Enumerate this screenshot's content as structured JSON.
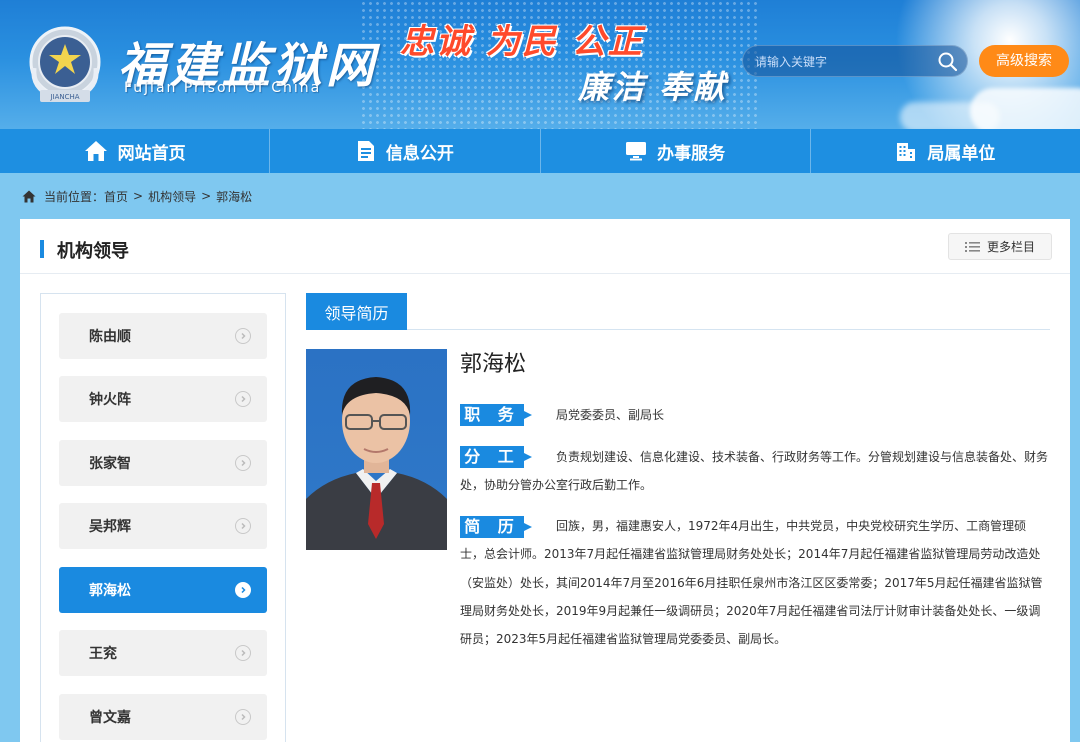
{
  "header": {
    "logo_cn": "福建监狱网",
    "logo_en": "Fujian Prison Of China",
    "emblem_text": "JIANCHA",
    "slogan_line1": "忠诚 为民 公正",
    "slogan_line2": "廉洁 奉献",
    "search_placeholder": "请输入关键字",
    "advanced_search_label": "高级搜索",
    "colors": {
      "primary": "#1a8ae0",
      "nav": "#1e8fe1",
      "accent_orange": "#ff8a17",
      "slogan_red": "#ff4a2b"
    }
  },
  "nav": {
    "items": [
      {
        "label": "网站首页",
        "icon": "home-icon"
      },
      {
        "label": "信息公开",
        "icon": "document-icon"
      },
      {
        "label": "办事服务",
        "icon": "monitor-icon"
      },
      {
        "label": "局属单位",
        "icon": "building-icon"
      }
    ]
  },
  "breadcrumb": {
    "prefix": "当前位置：",
    "items": [
      "首页",
      "机构领导",
      "郭海松"
    ],
    "separator": ">"
  },
  "panel": {
    "title": "机构领导",
    "more_label": "更多栏目"
  },
  "sidebar": {
    "items": [
      {
        "label": "陈由顺",
        "active": false
      },
      {
        "label": "钟火阵",
        "active": false
      },
      {
        "label": "张家智",
        "active": false
      },
      {
        "label": "吴邦辉",
        "active": false
      },
      {
        "label": "郭海松",
        "active": true
      },
      {
        "label": "王兖",
        "active": false
      },
      {
        "label": "曾文嘉",
        "active": false
      }
    ]
  },
  "content": {
    "tab_label": "领导简历",
    "name": "郭海松",
    "position_label": "职 务",
    "position_text": "局党委委员、副局长",
    "duty_label": "分 工",
    "duty_text": "负责规划建设、信息化建设、技术装备、行政财务等工作。分管规划建设与信息装备处、财务处，协助分管办公室行政后勤工作。",
    "bio_label": "简 历",
    "bio_text": "回族，男，福建惠安人，1972年4月出生，中共党员，中央党校研究生学历、工商管理硕士，总会计师。2013年7月起任福建省监狱管理局财务处处长；2014年7月起任福建省监狱管理局劳动改造处（安监处）处长，其间2014年7月至2016年6月挂职任泉州市洛江区区委常委；2017年5月起任福建省监狱管理局财务处处长，2019年9月起兼任一级调研员；2020年7月起任福建省司法厅计财审计装备处处长、一级调研员；2023年5月起任福建省监狱管理局党委委员、副局长。"
  }
}
